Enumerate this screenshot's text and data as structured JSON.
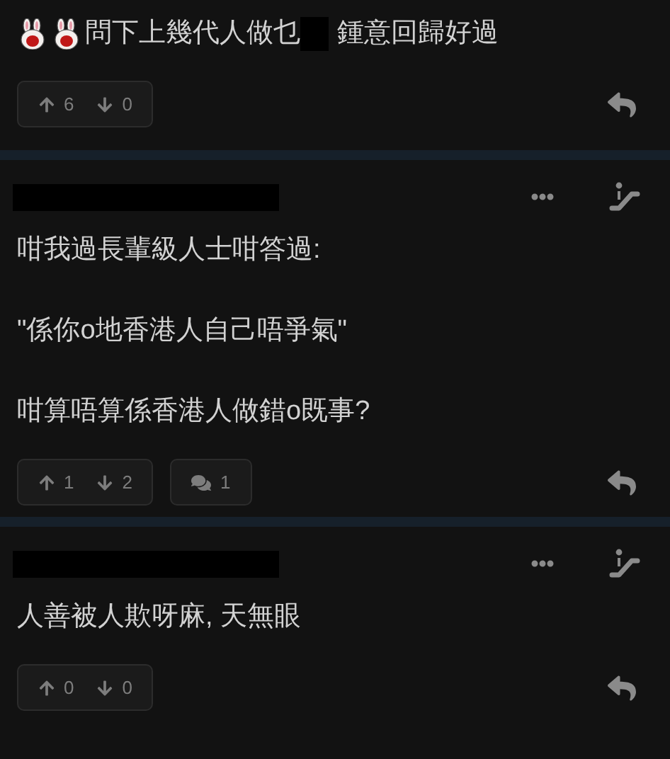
{
  "posts": [
    {
      "paragraphs": [
        [
          {
            "kind": "emoji"
          },
          {
            "kind": "emoji"
          },
          {
            "kind": "text",
            "text": "問下上幾代人做乜"
          },
          {
            "kind": "redacted"
          },
          {
            "kind": "text",
            "text": "鍾意回歸好過"
          }
        ]
      ],
      "votes": {
        "up": "6",
        "down": "0"
      }
    },
    {
      "header": {
        "redacted": true
      },
      "paragraphs": [
        [
          {
            "kind": "text",
            "text": "咁我過長輩級人士咁答過:"
          }
        ],
        [
          {
            "kind": "text",
            "text": "\"係你o地香港人自己唔爭氣\""
          }
        ],
        [
          {
            "kind": "text",
            "text": "咁算唔算係香港人做錯o既事?"
          }
        ]
      ],
      "votes": {
        "up": "1",
        "down": "2"
      },
      "replies": "1"
    },
    {
      "header": {
        "redacted": true
      },
      "paragraphs": [
        [
          {
            "kind": "text",
            "text": "人善被人欺呀麻, 天無眼"
          }
        ]
      ],
      "votes": {
        "up": "0",
        "down": "0"
      }
    }
  ]
}
